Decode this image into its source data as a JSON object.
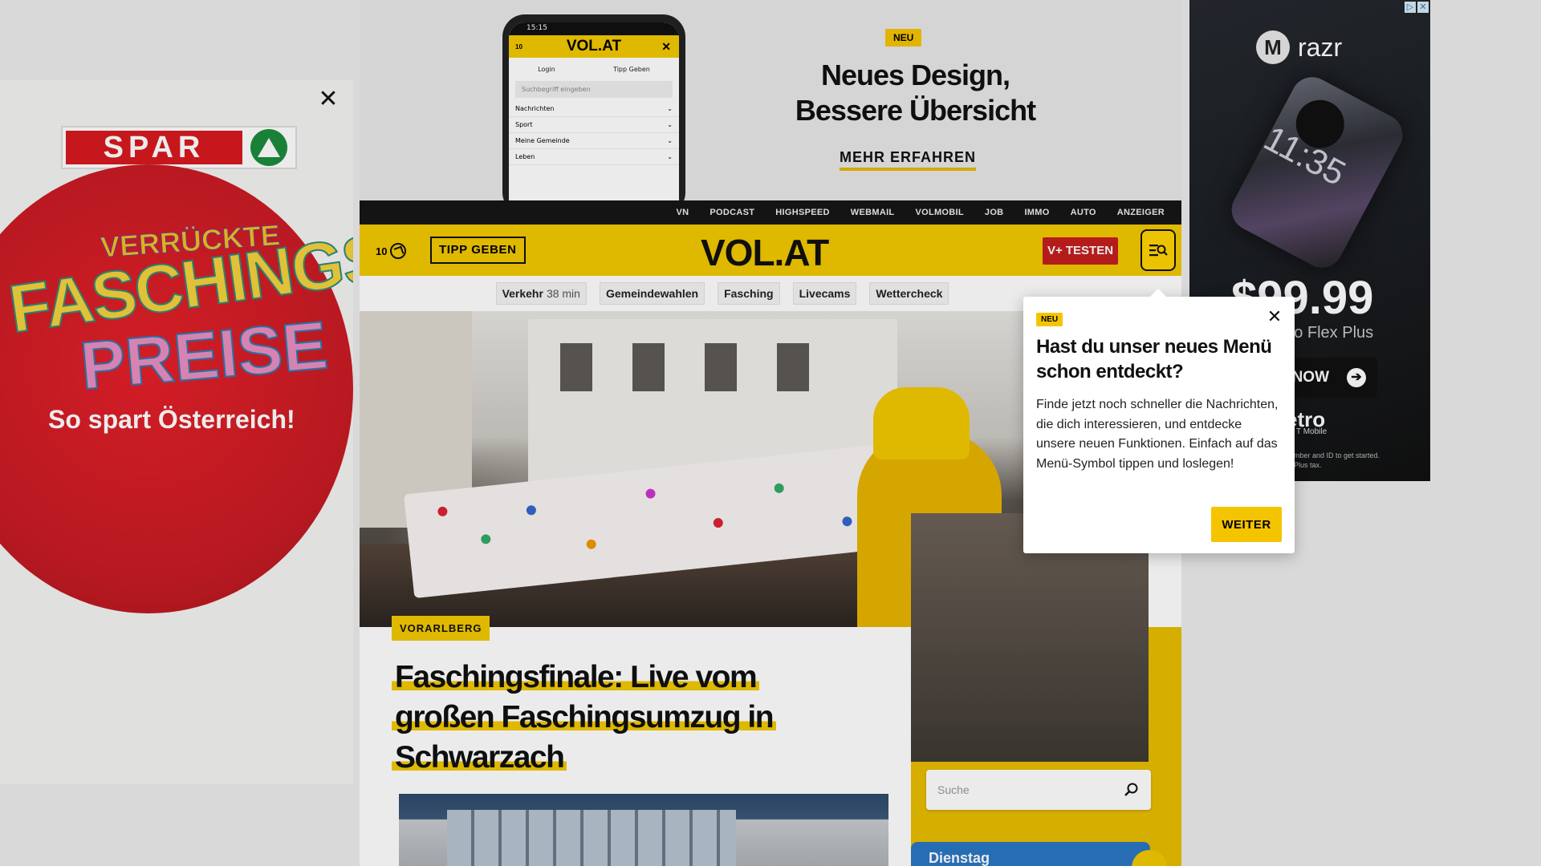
{
  "ads": {
    "left": {
      "brand": "SPAR",
      "line1": "VERRÜCKTE",
      "line2": "FASCHINGS",
      "line3": "PREISE",
      "tagline": "So spart Österreich!",
      "close_label": "✕"
    },
    "top": {
      "badge": "NEU",
      "title": "Neues Design, Bessere Übersicht",
      "cta": "MEHR ERFAHREN",
      "phone": {
        "status_time": "15:15",
        "logo": "VOL.AT",
        "count": "10",
        "close": "✕",
        "login": "Login",
        "tipp": "Tipp Geben",
        "search_placeholder": "Suchbegriff eingeben",
        "menu": [
          "Nachrichten",
          "Sport",
          "Meine Gemeinde",
          "Leben"
        ]
      }
    },
    "right": {
      "brand": "razr",
      "brand_mark": "M",
      "clock": "11:35",
      "price": "$99.99",
      "model": "tro Flex Plus",
      "cta": "NOW",
      "carrier": "etro",
      "carrier_sub": "T Mobile",
      "fine_print_1": "mber and ID to get started.",
      "fine_print_2": "Plus tax."
    }
  },
  "topnav": {
    "items": [
      "VN",
      "PODCAST",
      "HIGHSPEED",
      "WEBMAIL",
      "VOLMOBIL",
      "JOB",
      "IMMO",
      "AUTO",
      "ANZEIGER"
    ]
  },
  "header": {
    "count": "10",
    "tipp_label": "TIPP GEBEN",
    "logo": "VOL.AT",
    "vplus_label": "V+ TESTEN"
  },
  "subnav": {
    "verkehr_label": "Verkehr",
    "verkehr_value": "38 min",
    "items": [
      "Gemeindewahlen",
      "Fasching",
      "Livecams",
      "Wettercheck"
    ]
  },
  "article": {
    "category": "VORARLBERG",
    "headline_lines": [
      "Faschingsfinale: Live vom",
      "großen Faschingsumzug in",
      "Schwarzach"
    ]
  },
  "sidebar": {
    "search_placeholder": "Suche",
    "day_label": "Dienstag"
  },
  "popup": {
    "badge": "NEU",
    "title": "Hast du unser neues Menü schon entdeckt?",
    "text": "Finde jetzt noch schneller die Nachrichten, die dich interessieren, und entdecke unsere neuen Funktionen. Einfach auf das Menü-Symbol tippen und loslegen!",
    "button": "WEITER"
  },
  "colors": {
    "brand_yellow": "#f2c800",
    "vplus_red": "#c41f1f",
    "topnav_bg": "#161616",
    "day_card_blue": "#2b77c3"
  }
}
